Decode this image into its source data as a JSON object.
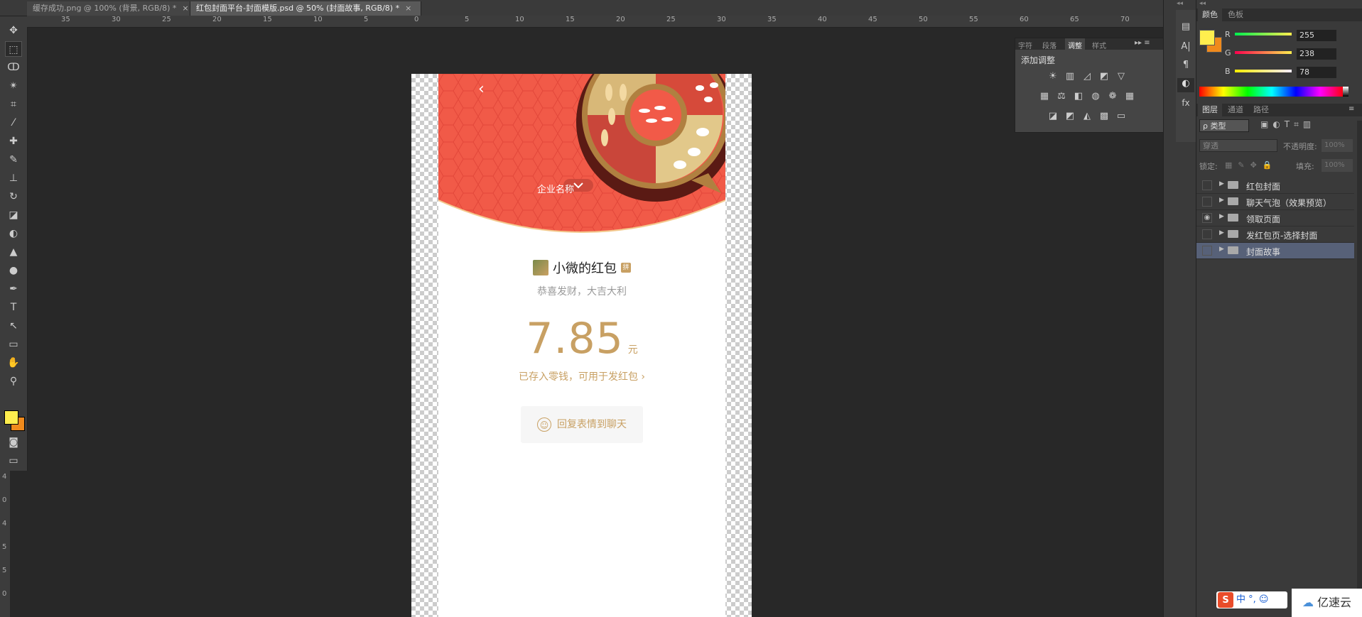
{
  "tabs": [
    {
      "label": "缓存成功.png @ 100% (背景, RGB/8) *",
      "close": "×"
    },
    {
      "label": "红包封面平台-封面模版.psd @ 50% (封面故事, RGB/8) *",
      "close": "×"
    }
  ],
  "ruler_h": [
    "35",
    "30",
    "25",
    "20",
    "15",
    "10",
    "5",
    "0",
    "5",
    "10",
    "15",
    "20",
    "25",
    "30",
    "35",
    "40",
    "45",
    "50",
    "55",
    "60",
    "65",
    "70"
  ],
  "ruler_v": [
    "4",
    "0",
    "4",
    "5",
    "5",
    "0"
  ],
  "tools": [
    "move-tool",
    "marquee-tool",
    "lasso-tool",
    "magic-wand-tool",
    "crop-tool",
    "eyedropper-tool",
    "healing-tool",
    "brush-tool",
    "stamp-tool",
    "history-brush-tool",
    "eraser-tool",
    "bucket-tool",
    "blur-tool",
    "dodge-tool",
    "pen-tool",
    "type-tool",
    "path-select-tool",
    "shape-tool",
    "hand-tool",
    "zoom-tool"
  ],
  "adjust_panel": {
    "tabs": [
      "字符",
      "段落",
      "调整",
      "样式"
    ],
    "active_tab": "调整",
    "title": "添加调整"
  },
  "color_panel": {
    "tabs": [
      "颜色",
      "色板"
    ],
    "active_tab": "颜色",
    "r_label": "R",
    "g_label": "G",
    "b_label": "B",
    "r": "255",
    "g": "238",
    "b": "78",
    "foreground": "#ffee4e",
    "background": "#f08a1c"
  },
  "layers_panel": {
    "tabs": [
      "图层",
      "通道",
      "路径"
    ],
    "active_tab": "图层",
    "filter_label": "ρ 类型",
    "blend_mode": "穿透",
    "opacity_label": "不透明度:",
    "opacity_value": "100%",
    "lock_label": "锁定:",
    "fill_label": "填充:",
    "fill_value": "100%",
    "layers": [
      {
        "name": "红包封面",
        "visible": false,
        "selected": false
      },
      {
        "name": "聊天气泡（效果预览）",
        "visible": false,
        "selected": false
      },
      {
        "name": "领取页面",
        "visible": true,
        "selected": false
      },
      {
        "name": "发红包页-选择封面",
        "visible": false,
        "selected": false
      },
      {
        "name": "封面故事",
        "visible": false,
        "selected": true
      }
    ]
  },
  "card": {
    "back_icon": "‹",
    "company_name": "企业名称",
    "sender": "小微的红包",
    "sender_badge": "拼",
    "blessing": "恭喜发财，大吉大利",
    "amount": "7.85",
    "unit": "元",
    "note": "已存入零钱，可用于发红包 ›",
    "reply_button": "回复表情到聊天",
    "red_color": "#f15a48",
    "gold_color": "#c8a063"
  },
  "watermark": {
    "ime_text": "中",
    "ime_symbols": "°, ☺",
    "brand": "亿速云"
  }
}
